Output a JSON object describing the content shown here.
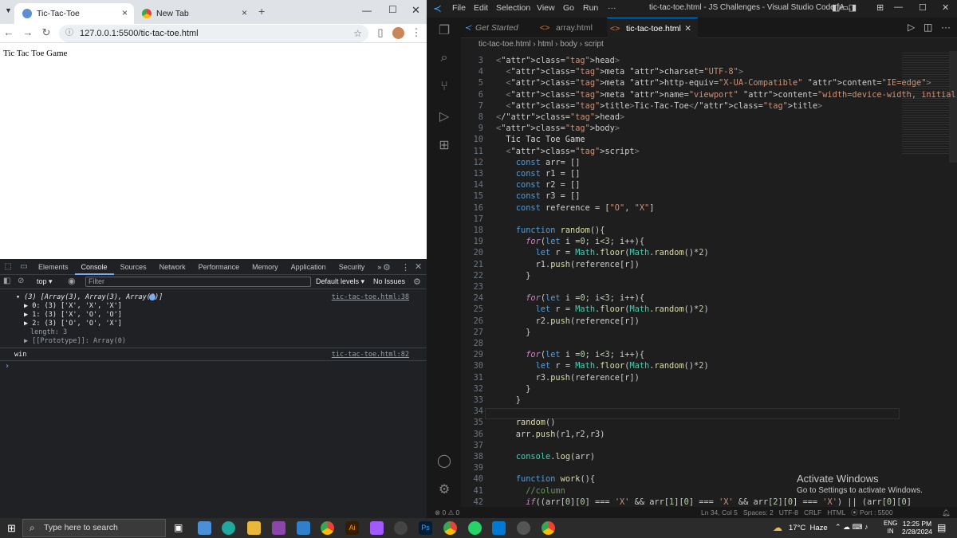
{
  "browser": {
    "tabs": [
      {
        "title": "Tic-Tac-Toe"
      },
      {
        "title": "New Tab"
      }
    ],
    "url": "127.0.0.1:5500/tic-tac-toe.html",
    "page_text": "Tic Tac Toe Game"
  },
  "devtools": {
    "tabs": [
      "Elements",
      "Console",
      "Sources",
      "Network",
      "Performance",
      "Memory",
      "Application",
      "Security"
    ],
    "more": "»",
    "context": "top",
    "filter_placeholder": "Filter",
    "levels": "Default levels",
    "issues": "No Issues",
    "console": {
      "array_summary": "▾ (3) [Array(3), Array(3), Array(3)]",
      "rows": [
        "▶ 0: (3) ['X', 'X', 'X']",
        "▶ 1: (3) ['X', 'O', 'O']",
        "▶ 2: (3) ['O', 'O', 'X']"
      ],
      "length": "length: 3",
      "prototype": "▶ [[Prototype]]: Array(0)",
      "win": "win",
      "src1": "tic-tac-toe.html:38",
      "src2": "tic-tac-toe.html:82",
      "prompt": "›"
    }
  },
  "vscode": {
    "menu": [
      "File",
      "Edit",
      "Selection",
      "View",
      "Go",
      "Run",
      "···"
    ],
    "title": "tic-tac-toe.html - JS Challenges - Visual Studio Code [A...",
    "tabs": [
      "Get Started",
      "array.html",
      "tic-tac-toe.html"
    ],
    "breadcrumb": [
      "tic-tac-toe.html",
      "html",
      "body",
      "script"
    ],
    "status_left": "⊗ 0 ⚠ 0",
    "status_right": "Ln 34, Col 5   Spaces: 2   UTF-8   CRLF   HTML   ⦿ Port : 5500",
    "lines": [
      {
        "n": "3",
        "code": "<head>"
      },
      {
        "n": "4",
        "code": "  <meta charset=\"UTF-8\">"
      },
      {
        "n": "5",
        "code": "  <meta http-equiv=\"X-UA-Compatible\" content=\"IE=edge\">"
      },
      {
        "n": "6",
        "code": "  <meta name=\"viewport\" content=\"width=device-width, initial-scale=1.0\">"
      },
      {
        "n": "7",
        "code": "  <title>Tic-Tac-Toe</title>"
      },
      {
        "n": "8",
        "code": "</head>"
      },
      {
        "n": "9",
        "code": "<body>"
      },
      {
        "n": "10",
        "code": "  Tic Tac Toe Game"
      },
      {
        "n": "11",
        "code": "  <script>"
      },
      {
        "n": "12",
        "code": "    const arr= []"
      },
      {
        "n": "13",
        "code": "    const r1 = []"
      },
      {
        "n": "14",
        "code": "    const r2 = []"
      },
      {
        "n": "15",
        "code": "    const r3 = []"
      },
      {
        "n": "16",
        "code": "    const reference = [\"O\", \"X\"]"
      },
      {
        "n": "17",
        "code": ""
      },
      {
        "n": "18",
        "code": "    function random(){"
      },
      {
        "n": "19",
        "code": "      for(let i =0; i<3; i++){"
      },
      {
        "n": "20",
        "code": "        let r = Math.floor(Math.random()*2)"
      },
      {
        "n": "21",
        "code": "        r1.push(reference[r])"
      },
      {
        "n": "22",
        "code": "      }"
      },
      {
        "n": "23",
        "code": ""
      },
      {
        "n": "24",
        "code": "      for(let i =0; i<3; i++){"
      },
      {
        "n": "25",
        "code": "        let r = Math.floor(Math.random()*2)"
      },
      {
        "n": "26",
        "code": "        r2.push(reference[r])"
      },
      {
        "n": "27",
        "code": "      }"
      },
      {
        "n": "28",
        "code": ""
      },
      {
        "n": "29",
        "code": "      for(let i =0; i<3; i++){"
      },
      {
        "n": "30",
        "code": "        let r = Math.floor(Math.random()*2)"
      },
      {
        "n": "31",
        "code": "        r3.push(reference[r])"
      },
      {
        "n": "32",
        "code": "      }"
      },
      {
        "n": "33",
        "code": "    }"
      },
      {
        "n": "34",
        "code": ""
      },
      {
        "n": "35",
        "code": "    random()"
      },
      {
        "n": "36",
        "code": "    arr.push(r1,r2,r3)"
      },
      {
        "n": "37",
        "code": ""
      },
      {
        "n": "38",
        "code": "    console.log(arr)"
      },
      {
        "n": "39",
        "code": ""
      },
      {
        "n": "40",
        "code": "    function work(){"
      },
      {
        "n": "41",
        "code": "      //column"
      },
      {
        "n": "42",
        "code": "      if((arr[0][0] === 'X' && arr[1][0] === 'X' && arr[2][0] === 'X') || (arr[0][0]"
      }
    ]
  },
  "watermark": {
    "title": "Activate Windows",
    "sub": "Go to Settings to activate Windows."
  },
  "taskbar": {
    "search": "Type here to search",
    "weather": "17°C  Haze",
    "lang1": "ENG",
    "lang2": "IN",
    "time": "12:25 PM",
    "date": "2/28/2024"
  }
}
